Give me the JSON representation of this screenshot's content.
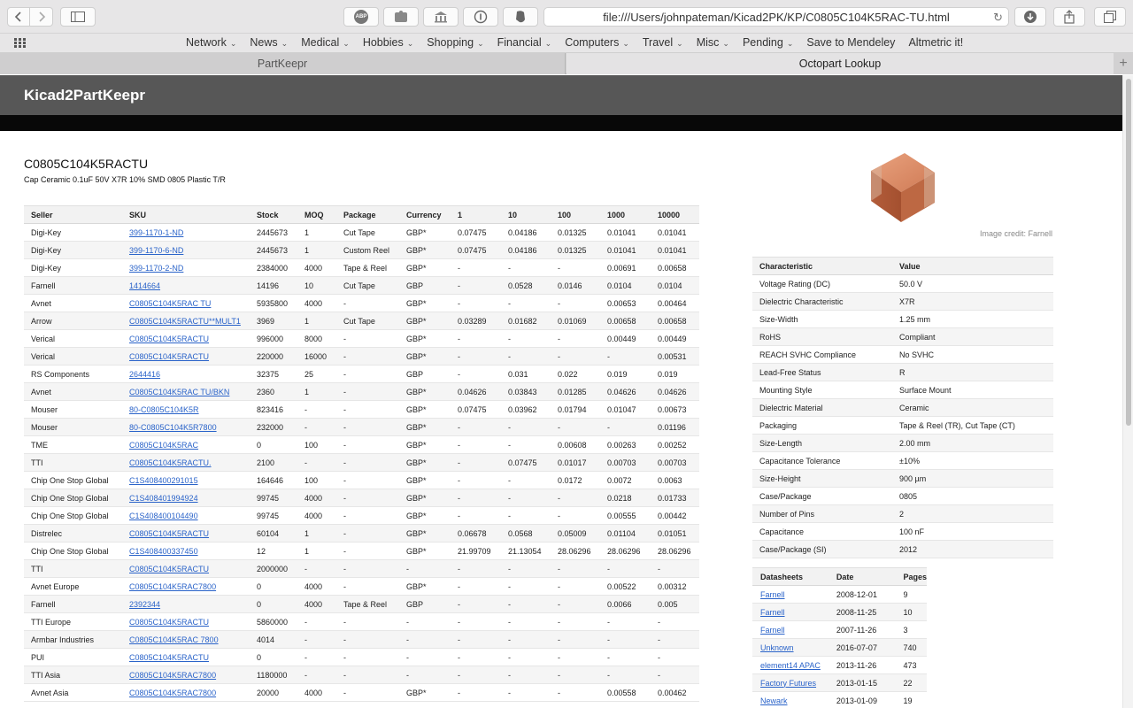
{
  "browser": {
    "url": "file:///Users/johnpateman/Kicad2PK/KP/C0805C104K5RAC-TU.html",
    "abp_label": "ABP",
    "favorites": [
      {
        "label": "Network",
        "menu": true
      },
      {
        "label": "News",
        "menu": true
      },
      {
        "label": "Medical",
        "menu": true
      },
      {
        "label": "Hobbies",
        "menu": true
      },
      {
        "label": "Shopping",
        "menu": true
      },
      {
        "label": "Financial",
        "menu": true
      },
      {
        "label": "Computers",
        "menu": true
      },
      {
        "label": "Travel",
        "menu": true
      },
      {
        "label": "Misc",
        "menu": true
      },
      {
        "label": "Pending",
        "menu": true
      },
      {
        "label": "Save to Mendeley",
        "menu": false
      },
      {
        "label": "Altmetric it!",
        "menu": false
      }
    ],
    "tabs": [
      {
        "label": "PartKeepr",
        "active": false
      },
      {
        "label": "Octopart Lookup",
        "active": true
      }
    ]
  },
  "page": {
    "site_title": "Kicad2PartKeepr",
    "part_number": "C0805C104K5RACTU",
    "description": "Cap Ceramic 0.1uF 50V X7R 10% SMD 0805 Plastic T/R",
    "image_credit": "Image credit: Farnell"
  },
  "offers": {
    "headers": [
      "Seller",
      "SKU",
      "Stock",
      "MOQ",
      "Package",
      "Currency",
      "1",
      "10",
      "100",
      "1000",
      "10000"
    ],
    "rows": [
      [
        "Digi-Key",
        "399-1170-1-ND",
        "2445673",
        "1",
        "Cut Tape",
        "GBP*",
        "0.07475",
        "0.04186",
        "0.01325",
        "0.01041",
        "0.01041"
      ],
      [
        "Digi-Key",
        "399-1170-6-ND",
        "2445673",
        "1",
        "Custom Reel",
        "GBP*",
        "0.07475",
        "0.04186",
        "0.01325",
        "0.01041",
        "0.01041"
      ],
      [
        "Digi-Key",
        "399-1170-2-ND",
        "2384000",
        "4000",
        "Tape & Reel",
        "GBP*",
        "-",
        "-",
        "-",
        "0.00691",
        "0.00658"
      ],
      [
        "Farnell",
        "1414664",
        "14196",
        "10",
        "Cut Tape",
        "GBP",
        "-",
        "0.0528",
        "0.0146",
        "0.0104",
        "0.0104"
      ],
      [
        "Avnet",
        "C0805C104K5RAC TU",
        "5935800",
        "4000",
        "-",
        "GBP*",
        "-",
        "-",
        "-",
        "0.00653",
        "0.00464"
      ],
      [
        "Arrow",
        "C0805C104K5RACTU**MULT1",
        "3969",
        "1",
        "Cut Tape",
        "GBP*",
        "0.03289",
        "0.01682",
        "0.01069",
        "0.00658",
        "0.00658"
      ],
      [
        "Verical",
        "C0805C104K5RACTU",
        "996000",
        "8000",
        "-",
        "GBP*",
        "-",
        "-",
        "-",
        "0.00449",
        "0.00449"
      ],
      [
        "Verical",
        "C0805C104K5RACTU",
        "220000",
        "16000",
        "-",
        "GBP*",
        "-",
        "-",
        "-",
        "-",
        "0.00531"
      ],
      [
        "RS Components",
        "2644416",
        "32375",
        "25",
        "-",
        "GBP",
        "-",
        "0.031",
        "0.022",
        "0.019",
        "0.019"
      ],
      [
        "Avnet",
        "C0805C104K5RAC TU/BKN",
        "2360",
        "1",
        "-",
        "GBP*",
        "0.04626",
        "0.03843",
        "0.01285",
        "0.04626",
        "0.04626"
      ],
      [
        "Mouser",
        "80-C0805C104K5R",
        "823416",
        "-",
        "-",
        "GBP*",
        "0.07475",
        "0.03962",
        "0.01794",
        "0.01047",
        "0.00673"
      ],
      [
        "Mouser",
        "80-C0805C104K5R7800",
        "232000",
        "-",
        "-",
        "GBP*",
        "-",
        "-",
        "-",
        "-",
        "0.01196"
      ],
      [
        "TME",
        "C0805C104K5RAC",
        "0",
        "100",
        "-",
        "GBP*",
        "-",
        "-",
        "0.00608",
        "0.00263",
        "0.00252"
      ],
      [
        "TTI",
        "C0805C104K5RACTU.",
        "2100",
        "-",
        "-",
        "GBP*",
        "-",
        "0.07475",
        "0.01017",
        "0.00703",
        "0.00703"
      ],
      [
        "Chip One Stop Global",
        "C1S408400291015",
        "164646",
        "100",
        "-",
        "GBP*",
        "-",
        "-",
        "0.0172",
        "0.0072",
        "0.0063"
      ],
      [
        "Chip One Stop Global",
        "C1S408401994924",
        "99745",
        "4000",
        "-",
        "GBP*",
        "-",
        "-",
        "-",
        "0.0218",
        "0.01733"
      ],
      [
        "Chip One Stop Global",
        "C1S408400104490",
        "99745",
        "4000",
        "-",
        "GBP*",
        "-",
        "-",
        "-",
        "0.00555",
        "0.00442"
      ],
      [
        "Distrelec",
        "C0805C104K5RACTU",
        "60104",
        "1",
        "-",
        "GBP*",
        "0.06678",
        "0.0568",
        "0.05009",
        "0.01104",
        "0.01051"
      ],
      [
        "Chip One Stop Global",
        "C1S408400337450",
        "12",
        "1",
        "-",
        "GBP*",
        "21.99709",
        "21.13054",
        "28.06296",
        "28.06296",
        "28.06296"
      ],
      [
        "TTI",
        "C0805C104K5RACTU",
        "2000000",
        "-",
        "-",
        "-",
        "-",
        "-",
        "-",
        "-",
        "-"
      ],
      [
        "Avnet Europe",
        "C0805C104K5RAC7800",
        "0",
        "4000",
        "-",
        "GBP*",
        "-",
        "-",
        "-",
        "0.00522",
        "0.00312"
      ],
      [
        "Farnell",
        "2392344",
        "0",
        "4000",
        "Tape & Reel",
        "GBP",
        "-",
        "-",
        "-",
        "0.0066",
        "0.005"
      ],
      [
        "TTI Europe",
        "C0805C104K5RACTU",
        "5860000",
        "-",
        "-",
        "-",
        "-",
        "-",
        "-",
        "-",
        "-"
      ],
      [
        "Armbar Industries",
        "C0805C104K5RAC 7800",
        "4014",
        "-",
        "-",
        "-",
        "-",
        "-",
        "-",
        "-",
        "-"
      ],
      [
        "PUI",
        "C0805C104K5RACTU",
        "0",
        "-",
        "-",
        "-",
        "-",
        "-",
        "-",
        "-",
        "-"
      ],
      [
        "TTI Asia",
        "C0805C104K5RAC7800",
        "1180000",
        "-",
        "-",
        "-",
        "-",
        "-",
        "-",
        "-",
        "-"
      ],
      [
        "Avnet Asia",
        "C0805C104K5RAC7800",
        "20000",
        "4000",
        "-",
        "GBP*",
        "-",
        "-",
        "-",
        "0.00558",
        "0.00462"
      ]
    ]
  },
  "specs": {
    "headers": [
      "Characteristic",
      "Value"
    ],
    "rows": [
      [
        "Voltage Rating (DC)",
        "50.0 V"
      ],
      [
        "Dielectric Characteristic",
        "X7R"
      ],
      [
        "Size-Width",
        "1.25 mm"
      ],
      [
        "RoHS",
        "Compliant"
      ],
      [
        "REACH SVHC Compliance",
        "No SVHC"
      ],
      [
        "Lead-Free Status",
        "R"
      ],
      [
        "Mounting Style",
        "Surface Mount"
      ],
      [
        "Dielectric Material",
        "Ceramic"
      ],
      [
        "Packaging",
        "Tape & Reel (TR), Cut Tape (CT)"
      ],
      [
        "Size-Length",
        "2.00 mm"
      ],
      [
        "Capacitance Tolerance",
        "±10%"
      ],
      [
        "Size-Height",
        "900 µm"
      ],
      [
        "Case/Package",
        "0805"
      ],
      [
        "Number of Pins",
        "2"
      ],
      [
        "Capacitance",
        "100 nF"
      ],
      [
        "Case/Package (SI)",
        "2012"
      ]
    ]
  },
  "datasheets": {
    "headers": [
      "Datasheets",
      "Date",
      "Pages"
    ],
    "rows": [
      [
        "Farnell",
        "2008-12-01",
        "9"
      ],
      [
        "Farnell",
        "2008-11-25",
        "10"
      ],
      [
        "Farnell",
        "2007-11-26",
        "3"
      ],
      [
        "Unknown",
        "2016-07-07",
        "740"
      ],
      [
        "element14 APAC",
        "2013-11-26",
        "473"
      ],
      [
        "Factory Futures",
        "2013-01-15",
        "22"
      ],
      [
        "Newark",
        "2013-01-09",
        "19"
      ]
    ]
  },
  "colors": {
    "header_bg": "#575757",
    "link": "#2a63c9",
    "capacitor": "#c8704a"
  }
}
